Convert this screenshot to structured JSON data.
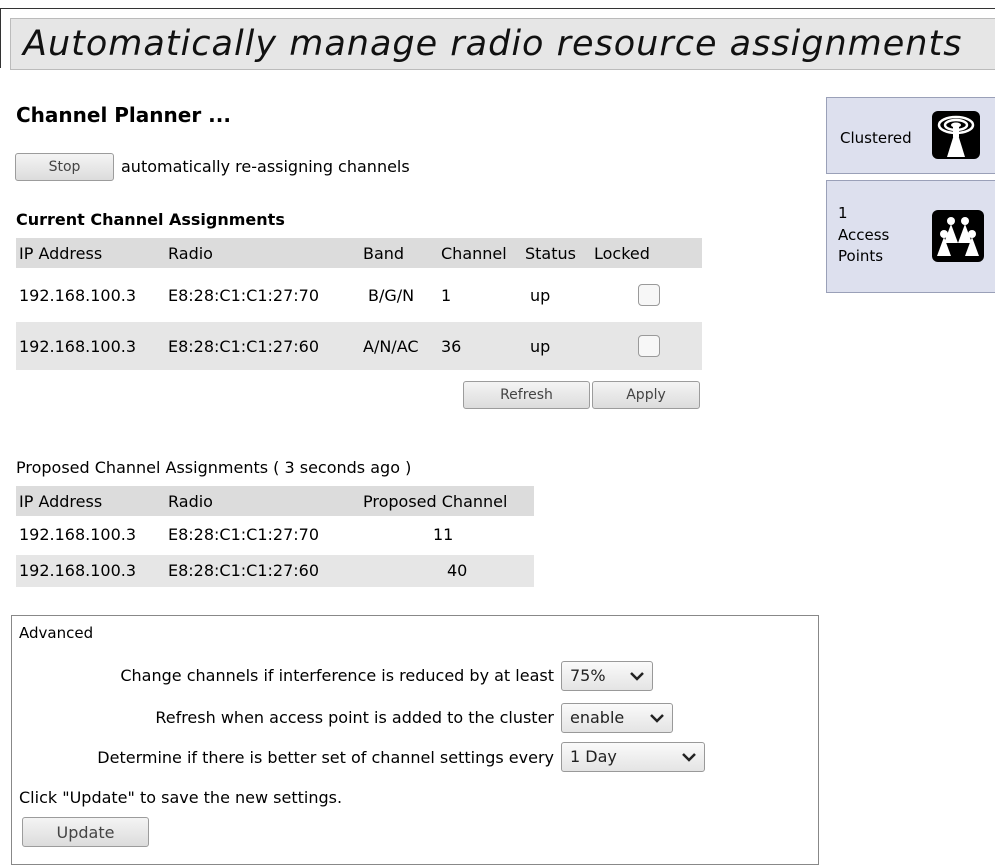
{
  "page": {
    "title": "Automatically manage radio resource assignments"
  },
  "planner": {
    "heading": "Channel Planner ...",
    "stop_label": "Stop",
    "status_text": "automatically re-assigning channels"
  },
  "current": {
    "heading": "Current Channel Assignments",
    "columns": [
      "IP Address",
      "Radio",
      "Band",
      "Channel",
      "Status",
      "Locked"
    ],
    "rows": [
      {
        "ip": "192.168.100.3",
        "radio": "E8:28:C1:C1:27:70",
        "band": "B/G/N",
        "channel": "1",
        "status": "up",
        "locked": false
      },
      {
        "ip": "192.168.100.3",
        "radio": "E8:28:C1:C1:27:60",
        "band": "A/N/AC",
        "channel": "36",
        "status": "up",
        "locked": false
      }
    ],
    "refresh_label": "Refresh",
    "apply_label": "Apply"
  },
  "proposed": {
    "heading": "Proposed Channel Assignments ( 3 seconds ago )",
    "columns": [
      "IP Address",
      "Radio",
      "Proposed Channel"
    ],
    "rows": [
      {
        "ip": "192.168.100.3",
        "radio": "E8:28:C1:C1:27:70",
        "channel": "11"
      },
      {
        "ip": "192.168.100.3",
        "radio": "E8:28:C1:C1:27:60",
        "channel": "40"
      }
    ]
  },
  "advanced": {
    "heading": "Advanced",
    "interference_label": "Change channels if interference is reduced by at least",
    "interference_value": "75%",
    "refresh_label": "Refresh when access point is added to the cluster",
    "refresh_value": "enable",
    "interval_label": "Determine if there is better set of channel settings every",
    "interval_value": "1 Day",
    "hint": "Click \"Update\" to save the new settings.",
    "update_label": "Update"
  },
  "side": {
    "clustered_label": "Clustered",
    "clustered_icon": "cluster-antenna-icon",
    "ap_count": "1",
    "ap_label_1": "Access",
    "ap_label_2": "Points",
    "ap_icon": "access-points-icon"
  }
}
